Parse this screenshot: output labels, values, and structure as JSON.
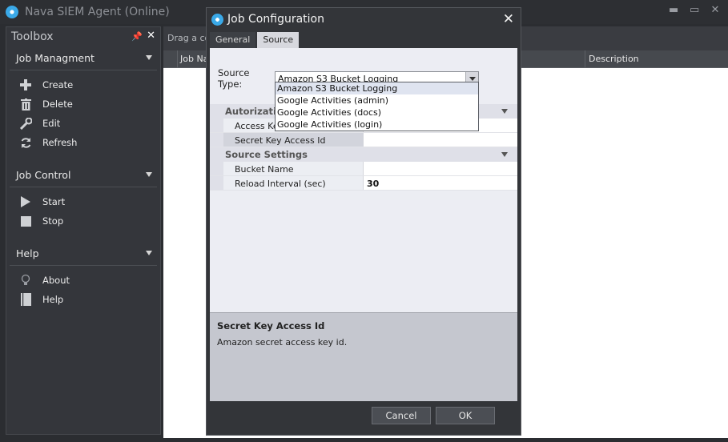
{
  "app": {
    "title": "Nava SIEM Agent (Online)",
    "controls": {
      "minimize": "▬",
      "maximize": "▭",
      "close": "✕"
    }
  },
  "toolbox": {
    "title": "Toolbox",
    "pin_icon": "pin-icon",
    "close_icon": "close-icon",
    "sections": [
      {
        "title": "Job Managment",
        "items": [
          "Create",
          "Delete",
          "Edit",
          "Refresh"
        ]
      },
      {
        "title": "Job Control",
        "items": [
          "Start",
          "Stop"
        ]
      },
      {
        "title": "Help",
        "items": [
          "About",
          "Help"
        ]
      }
    ]
  },
  "grid": {
    "group_hint": "Drag a co",
    "columns": [
      "Job Na",
      "Description"
    ]
  },
  "dialog": {
    "title": "Job Configuration",
    "tabs": [
      "General",
      "Source"
    ],
    "active_tab": "Source",
    "source_type_label": "Source Type:",
    "source_type_value": "Amazon S3 Bucket Logging",
    "dropdown_options": [
      "Amazon S3 Bucket Logging",
      "Google Activities (admin)",
      "Google Activities (docs)",
      "Google Activities (login)"
    ],
    "categories": [
      {
        "title": "Autorization",
        "rows": [
          {
            "name": "Access Ke",
            "value": ""
          },
          {
            "name": "Secret Key Access Id",
            "value": ""
          }
        ]
      },
      {
        "title": "Source Settings",
        "rows": [
          {
            "name": "Bucket Name",
            "value": ""
          },
          {
            "name": "Reload Interval (sec)",
            "value": "30"
          }
        ]
      }
    ],
    "description_title": "Secret Key Access Id",
    "description_text": "Amazon secret access key id.",
    "cancel_label": "Cancel",
    "ok_label": "OK"
  },
  "colors": {
    "accent": "#3aa9e8",
    "background": "#2b2d31",
    "dialog_panel": "#ecedf3"
  }
}
